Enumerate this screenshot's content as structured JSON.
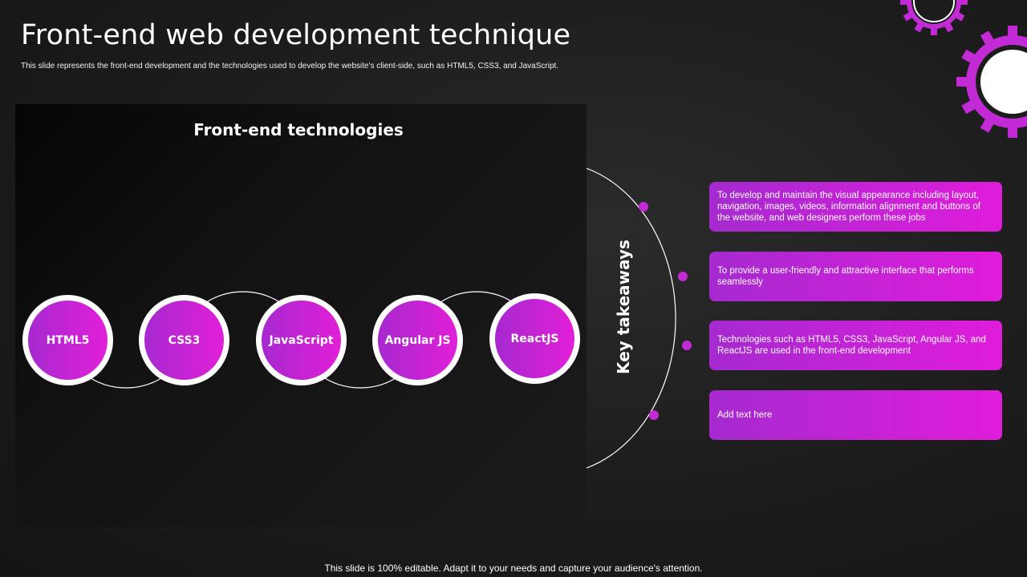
{
  "title": "Front-end web development technique",
  "subtitle": "This slide represents the front-end development and the technologies used to develop the website's client-side, such as HTML5, CSS3, and JavaScript.",
  "panel": {
    "title": "Front-end technologies",
    "technologies": [
      "HTML5",
      "CSS3",
      "JavaScript",
      "Angular JS",
      "ReactJS"
    ]
  },
  "key_takeaways": {
    "label": "Key takeaways",
    "items": [
      "To develop and maintain the visual appearance including layout, navigation, images, videos, information alignment and buttons of the website, and web designers perform these jobs",
      "To provide a user-friendly and attractive interface that performs seamlessly",
      "Technologies such as HTML5, CSS3, JavaScript, Angular JS, and ReactJS are used in the front-end development",
      "Add text here"
    ]
  },
  "footer": "This slide is 100% editable. Adapt it to your needs and capture your audience's attention.",
  "colors": {
    "accent_start": "#a629cf",
    "accent_end": "#e21fd8",
    "dot": "#c22ad6",
    "background": "#1c1c1c"
  },
  "icons": [
    "gear-icon-small",
    "gear-icon-large"
  ]
}
